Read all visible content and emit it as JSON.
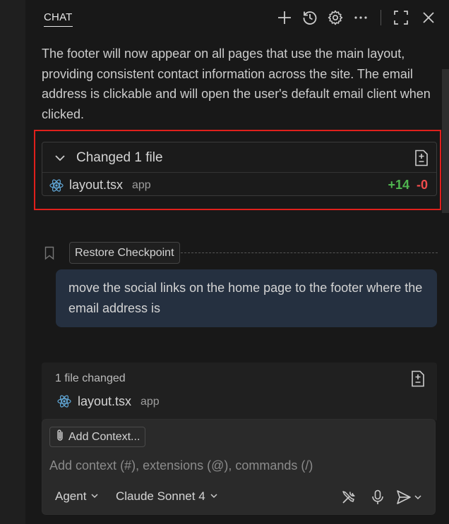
{
  "header": {
    "tab_label": "CHAT",
    "icons": [
      "plus-icon",
      "history-icon",
      "gear-icon",
      "more-icon",
      "maximize-icon",
      "close-icon"
    ]
  },
  "assistant_message": {
    "text": "The footer will now appear on all pages that use the main layout, providing consistent contact information across the site. The email address is clickable and will open the user's default email client when clicked."
  },
  "changed_files": {
    "title": "Changed 1 file",
    "files": [
      {
        "name": "layout.tsx",
        "dir": "app",
        "added": "+14",
        "removed": "-0"
      }
    ]
  },
  "checkpoint": {
    "label": "Restore Checkpoint"
  },
  "user_message": {
    "text": "move the social links on the home page to the footer where the email address is"
  },
  "summary": {
    "count_label": "1 file changed",
    "file_name": "layout.tsx",
    "file_dir": "app"
  },
  "input": {
    "add_context_label": "Add Context...",
    "placeholder": "Add context (#), extensions (@), commands (/)",
    "mode": "Agent",
    "model": "Claude Sonnet 4"
  },
  "colors": {
    "added": "#4fb54f",
    "removed": "#f14c4c",
    "highlight": "#e0201c",
    "react": "#61a8d8"
  }
}
